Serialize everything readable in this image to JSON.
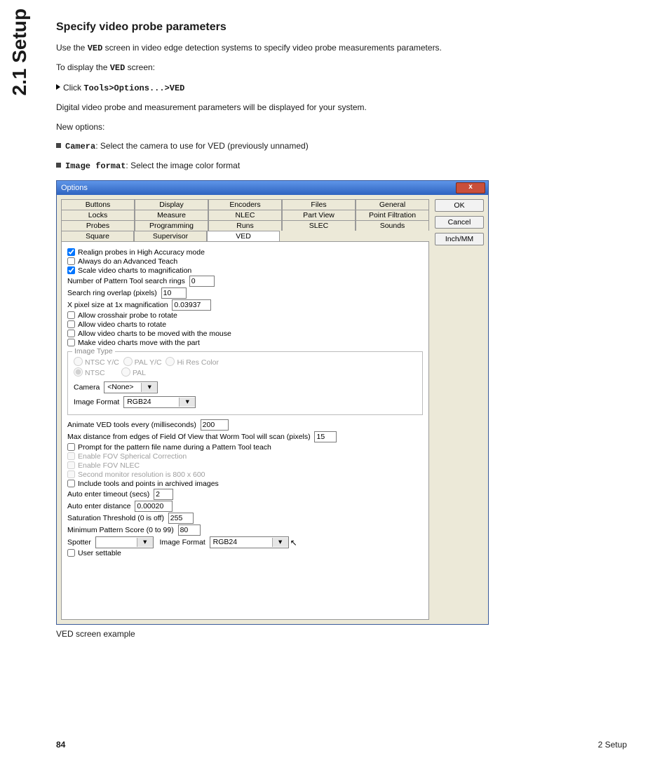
{
  "sideTab": "2.1 Setup",
  "heading": "Specify video probe parameters",
  "para1_a": "Use the ",
  "para1_b": "VED",
  "para1_c": " screen in video edge detection systems to specify video probe measurements parameters.",
  "para2_a": "To display the ",
  "para2_b": "VED",
  "para2_c": " screen:",
  "step1_a": "Click ",
  "step1_b": "Tools>Options...>VED",
  "para3": "Digital video probe and measurement parameters will be displayed for your system.",
  "para4": "New options:",
  "bul1_a": "Camera",
  "bul1_b": ": Select the camera to use for VED (previously unnamed)",
  "bul2_a": "Image format",
  "bul2_b": ": Select the image color format",
  "caption": "VED screen example",
  "pageNum": "84",
  "chapter": "2 Setup",
  "dlg": {
    "title": "Options",
    "close": "x",
    "btnOK": "OK",
    "btnCancel": "Cancel",
    "btnInch": "Inch/MM",
    "tabs": {
      "r1": [
        "Buttons",
        "Display",
        "Encoders",
        "Files",
        "General"
      ],
      "r2": [
        "Locks",
        "Measure",
        "NLEC",
        "Part View",
        "Point Filtration"
      ],
      "r3": [
        "Probes",
        "Programming",
        "Runs",
        "SLEC",
        "Sounds"
      ],
      "r4": [
        "Square",
        "Supervisor",
        "VED"
      ]
    },
    "c": {
      "realign": "Realign probes in High Accuracy mode",
      "advTeach": "Always do an Advanced Teach",
      "scale": "Scale video charts to magnification",
      "rings": "Number of Pattern Tool search rings",
      "rings_v": "0",
      "overlap": "Search ring overlap (pixels)",
      "overlap_v": "10",
      "xpix": "X pixel size at 1x magnification",
      "xpix_v": "0.03937",
      "crosshair": "Allow crosshair probe to rotate",
      "chartsRot": "Allow video charts to rotate",
      "chartsMouse": "Allow video charts to be moved with the mouse",
      "chartsPart": "Make video charts move with the part",
      "grpImage": "Image Type",
      "rNTSCYC": "NTSC Y/C",
      "rPALYC": "PAL Y/C",
      "rHiRes": "Hi Res Color",
      "rNTSC": "NTSC",
      "rPAL": "PAL",
      "camera": "Camera",
      "camera_v": "<None>",
      "imgFmt": "Image Format",
      "imgFmt_v": "RGB24",
      "anim": "Animate VED tools every (milliseconds)",
      "anim_v": "200",
      "maxDist": "Max distance from edges of Field Of View that Worm Tool will scan (pixels)",
      "maxDist_v": "15",
      "prompt": "Prompt for the pattern file name during a Pattern Tool teach",
      "fovSph": "Enable FOV Spherical Correction",
      "fovNlec": "Enable FOV NLEC",
      "secMon": "Second monitor resolution is 800 x 600",
      "incTools": "Include tools and points in archived images",
      "autoTO": "Auto enter timeout (secs)",
      "autoTO_v": "2",
      "autoDist": "Auto enter distance",
      "autoDist_v": "0.00020",
      "sat": "Saturation Threshold (0 is off)",
      "sat_v": "255",
      "minPat": "Minimum Pattern Score (0 to 99)",
      "minPat_v": "80",
      "spotter": "Spotter",
      "spImgFmt": "Image Format",
      "spImgFmt_v": "RGB24",
      "userSet": "User settable"
    }
  }
}
